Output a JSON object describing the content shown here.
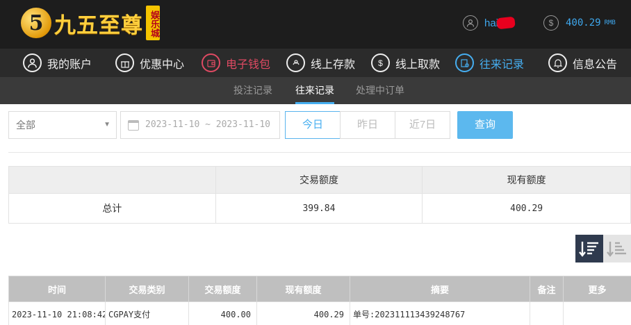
{
  "header": {
    "logo_digit": "5",
    "logo_text": "九五至尊",
    "logo_tag": "娱乐城",
    "username": "hai",
    "balance": "400.29",
    "balance_unit": "RMB"
  },
  "nav": [
    {
      "label": "我的账户",
      "icon": "user-icon"
    },
    {
      "label": "优惠中心",
      "icon": "gift-icon"
    },
    {
      "label": "电子钱包",
      "icon": "wallet-icon",
      "color": "#e04a63"
    },
    {
      "label": "线上存款",
      "icon": "deposit-icon"
    },
    {
      "label": "线上取款",
      "icon": "withdraw-icon"
    },
    {
      "label": "往来记录",
      "icon": "records-icon",
      "color": "#46aef0"
    },
    {
      "label": "信息公告",
      "icon": "bell-icon"
    }
  ],
  "subnav": [
    {
      "label": "投注记录"
    },
    {
      "label": "往来记录",
      "active": true
    },
    {
      "label": "处理中订单"
    }
  ],
  "filters": {
    "type_selected": "全部",
    "date_range": "2023-11-10 ~ 2023-11-10",
    "quick": [
      "今日",
      "昨日",
      "近7日"
    ],
    "active_quick": "今日",
    "query_label": "查询"
  },
  "summary": {
    "headers": [
      "",
      "交易额度",
      "现有额度"
    ],
    "row_label": "总计",
    "trade_amount": "399.84",
    "current_amount": "400.29"
  },
  "records": {
    "columns": [
      "时间",
      "交易类别",
      "交易额度",
      "现有额度",
      "摘要",
      "备注",
      "更多"
    ],
    "rows": [
      [
        "2023-11-10 21:08:42",
        "CGPAY支付",
        "400.00",
        "400.29",
        "单号:202311113439248767",
        "",
        ""
      ]
    ]
  },
  "colors": {
    "accent_blue": "#46aef0",
    "accent_red": "#e04a63",
    "header_bg": "#1d1d1d"
  }
}
